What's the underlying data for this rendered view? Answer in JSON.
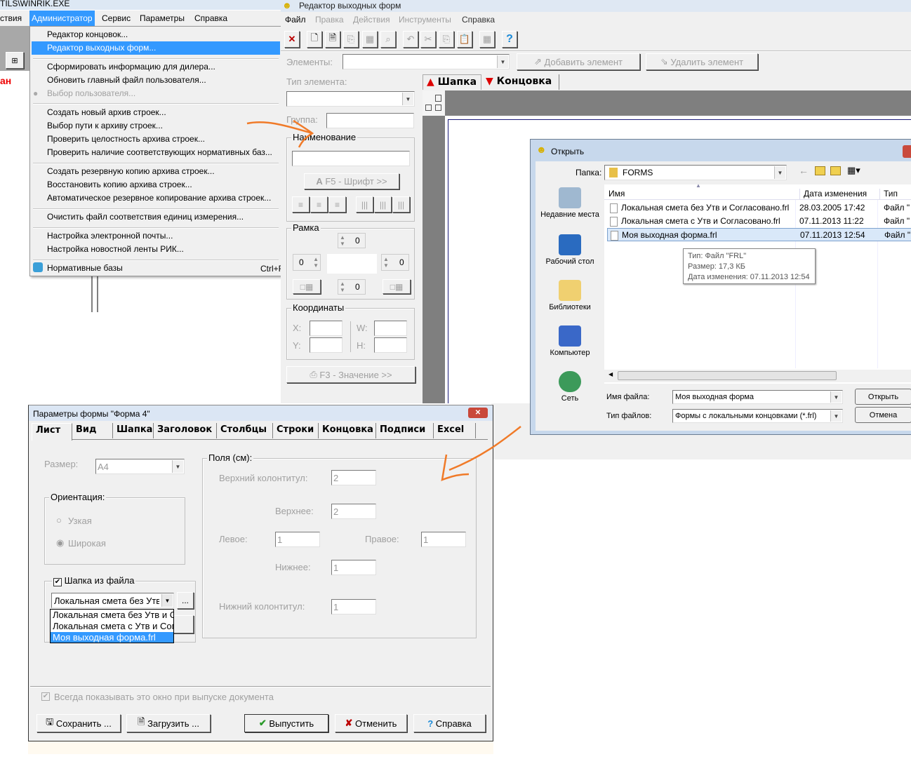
{
  "bg_app": {
    "title": "TILS\\WINRIK.EXE",
    "menu": [
      "ствия",
      "Администратор",
      "Сервис",
      "Параметры",
      "Справка"
    ],
    "red_text": "ан",
    "admin_menu": [
      {
        "label": "Редактор концовок..."
      },
      {
        "label": "Редактор выходных форм...",
        "highlighted": true
      },
      {
        "label": "Сформировать информацию для дилера..."
      },
      {
        "label": "Обновить главный файл пользователя..."
      },
      {
        "label": "Выбор пользователя...",
        "disabled": true
      },
      {
        "label": "Создать новый архив строек..."
      },
      {
        "label": "Выбор пути к архиву строек..."
      },
      {
        "label": "Проверить целостность архива строек..."
      },
      {
        "label": "Проверить наличие соответствующих нормативных баз..."
      },
      {
        "label": "Создать резервную копию архива строек..."
      },
      {
        "label": "Восстановить копию архива строек..."
      },
      {
        "label": "Автоматическое резервное копирование архива строек..."
      },
      {
        "label": "Очистить файл соответствия единиц измерения..."
      },
      {
        "label": "Настройка электронной почты..."
      },
      {
        "label": "Настройка новостной ленты РИК..."
      },
      {
        "label": "Нормативные базы",
        "shortcut": "Ctrl+F"
      }
    ]
  },
  "editor": {
    "title": "Редактор выходных форм",
    "menu": [
      "Файл",
      "Правка",
      "Действия",
      "Инструменты",
      "Справка"
    ],
    "toolbar_icons": [
      "close-icon",
      "new-icon",
      "open-icon",
      "save-icon",
      "save-as-icon",
      "preview-icon",
      "undo-icon",
      "cut-icon",
      "copy-icon",
      "paste-icon",
      "grid-icon",
      "help-icon"
    ],
    "elements_label": "Элементы:",
    "elements_value": "",
    "add_element": "Добавить элемент",
    "delete_element": "Удалить элемент",
    "element_type_label": "Тип элемента:",
    "group_label": "Группа:",
    "name_group": "Наименование",
    "font_button": "F5 - Шрифт >>",
    "frame_group": "Рамка",
    "frame_values": {
      "top": "0",
      "left": "0",
      "right": "0",
      "bottom": "0"
    },
    "coords_group": "Координаты",
    "coords_labels": {
      "x": "X:",
      "y": "Y:",
      "w": "W:",
      "h": "H:"
    },
    "value_button": "F3 - Значение >>",
    "tabs": [
      "Шапка",
      "Концовка"
    ]
  },
  "open_dialog": {
    "title": "Открыть",
    "folder_label": "Папка:",
    "folder_value": "FORMS",
    "places": [
      "Недавние места",
      "Рабочий стол",
      "Библиотеки",
      "Компьютер",
      "Сеть"
    ],
    "columns": [
      "Имя",
      "Дата изменения",
      "Тип"
    ],
    "files": [
      {
        "name": "Локальная смета без Утв и Согласовано.frl",
        "date": "28.03.2005 17:42",
        "type": "Файл \""
      },
      {
        "name": "Локальная смета с Утв и Согласовано.frl",
        "date": "07.11.2013 11:22",
        "type": "Файл \""
      },
      {
        "name": "Моя выходная форма.frl",
        "date": "07.11.2013 12:54",
        "type": "Файл \"",
        "selected": true
      }
    ],
    "tooltip": [
      "Тип: Файл \"FRL\"",
      "Размер: 17,3 КБ",
      "Дата изменения: 07.11.2013 12:54"
    ],
    "filename_label": "Имя файла:",
    "filename_value": "Моя выходная форма",
    "filetype_label": "Тип файлов:",
    "filetype_value": "Формы с локальными концовками (*.frl)",
    "open_button": "Открыть",
    "cancel_button": "Отмена"
  },
  "params_dialog": {
    "title": "Параметры формы \"Форма 4\"",
    "tabs": [
      "Лист",
      "Вид",
      "Шапка",
      "Заголовок",
      "Столбцы",
      "Строки",
      "Концовка",
      "Подписи",
      "Excel"
    ],
    "active_tab": "Лист",
    "size_label": "Размер:",
    "size_value": "A4",
    "orientation_group": "Ориентация:",
    "orientation_options": [
      "Узкая",
      "Широкая"
    ],
    "orientation_selected": "Широкая",
    "header_from_file_label": "Шапка из файла",
    "header_from_file_checked": true,
    "header_combo_value": "Локальная смета без Утв и Согласовано",
    "header_combo_options": [
      "Локальная смета без Утв и Согласовано",
      "Локальная смета с Утв и Согласовано",
      "Моя выходная форма.frl"
    ],
    "browse_button": "...",
    "margins_group": "Поля (см):",
    "margins": {
      "top_header": {
        "label": "Верхний колонтитул:",
        "value": "2"
      },
      "top": {
        "label": "Верхнее:",
        "value": "2"
      },
      "left": {
        "label": "Левое:",
        "value": "1"
      },
      "right": {
        "label": "Правое:",
        "value": "1"
      },
      "bottom": {
        "label": "Нижнее:",
        "value": "1"
      },
      "bottom_footer": {
        "label": "Нижний колонтитул:",
        "value": "1"
      }
    },
    "always_show_label": "Всегда показывать это окно при выпуске документа",
    "always_show_checked": true,
    "buttons": {
      "save": "Сохранить ...",
      "load": "Загрузить ...",
      "issue": "Выпустить",
      "cancel": "Отменить",
      "help": "Справка"
    }
  },
  "colors": {
    "highlight": "#3399ff",
    "annotation": "#f07a28",
    "dialog_title": "#dbe6f4"
  }
}
